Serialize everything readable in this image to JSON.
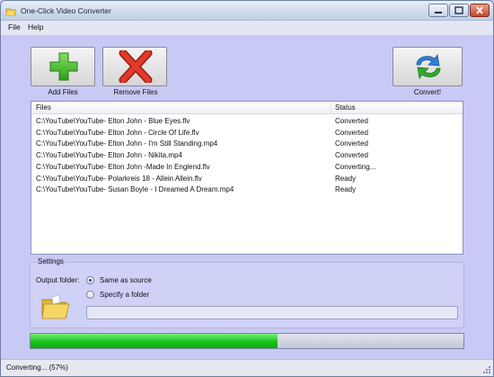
{
  "window": {
    "title": "One-Click Video Converter"
  },
  "menu": {
    "items": [
      "File",
      "Help"
    ]
  },
  "toolbar": {
    "add_label": "Add Files",
    "remove_label": "Remove Files",
    "convert_label": "Convert!"
  },
  "filelist": {
    "headers": {
      "files": "Files",
      "status": "Status"
    },
    "rows": [
      {
        "file": "C:\\YouTube\\YouTube- Elton John - Blue Eyes.flv",
        "status": "Converted"
      },
      {
        "file": "C:\\YouTube\\YouTube- Elton John - Circle Of Life.flv",
        "status": "Converted"
      },
      {
        "file": "C:\\YouTube\\YouTube- Elton John - I'm Still Standing.mp4",
        "status": "Converted"
      },
      {
        "file": "C:\\YouTube\\YouTube- Elton John - Nikita.mp4",
        "status": "Converted"
      },
      {
        "file": "C:\\YouTube\\YouTube- Elton John -Made In Englend.flv",
        "status": "Converting..."
      },
      {
        "file": "C:\\YouTube\\YouTube- Polarkreis 18 - Allein Allein.flv",
        "status": "Ready"
      },
      {
        "file": "C:\\YouTube\\YouTube- Susan Boyle - I Dreamed A Dream.mp4",
        "status": "Ready"
      }
    ]
  },
  "settings": {
    "legend": "Settings",
    "output_label": "Output folder:",
    "option_same": "Same as source",
    "option_specify": "Specify a folder",
    "selected": "same",
    "folder_value": ""
  },
  "progress": {
    "fraction": 0.57
  },
  "status": {
    "text": "Converting... (57%)"
  },
  "colors": {
    "accent_green": "#17c31a",
    "remove_red": "#d52a1e",
    "convert_blue": "#2f7fd0",
    "convert_green": "#35a82c"
  }
}
